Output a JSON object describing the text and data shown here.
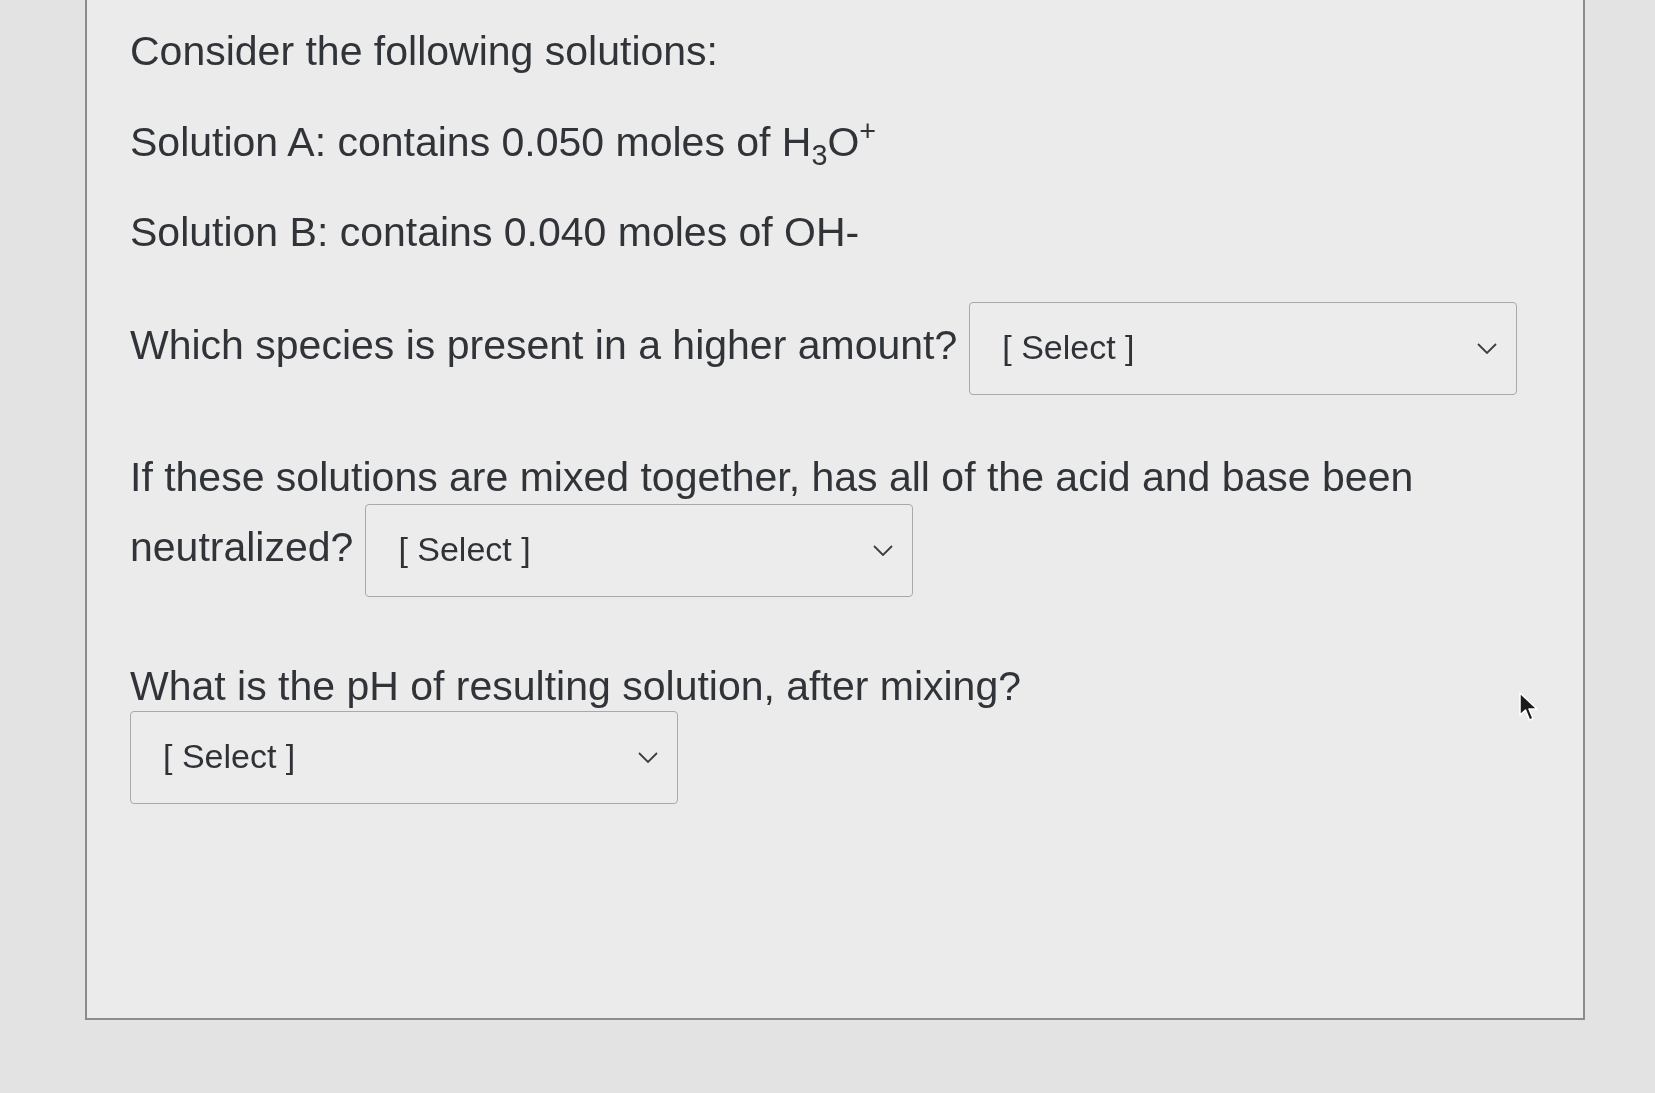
{
  "intro": "Consider the following solutions:",
  "solutions": [
    "Solution A: contains 0.050 moles of H$_{3}$O$^{+}$",
    "Solution B: contains 0.040 moles of OH-"
  ],
  "questions": [
    {
      "kind": "inline",
      "lines": [
        "Which species is present in a higher amount?"
      ],
      "select": {
        "placeholder": "[ Select ]"
      }
    },
    {
      "kind": "inline",
      "lines": [
        "If these solutions are mixed together, has all of the acid and base been",
        "neutralized?"
      ],
      "select": {
        "placeholder": "[ Select ]"
      }
    },
    {
      "kind": "below",
      "lines": [
        "What is the pH of resulting solution, after mixing?"
      ],
      "select": {
        "placeholder": "[ Select ]"
      }
    }
  ]
}
